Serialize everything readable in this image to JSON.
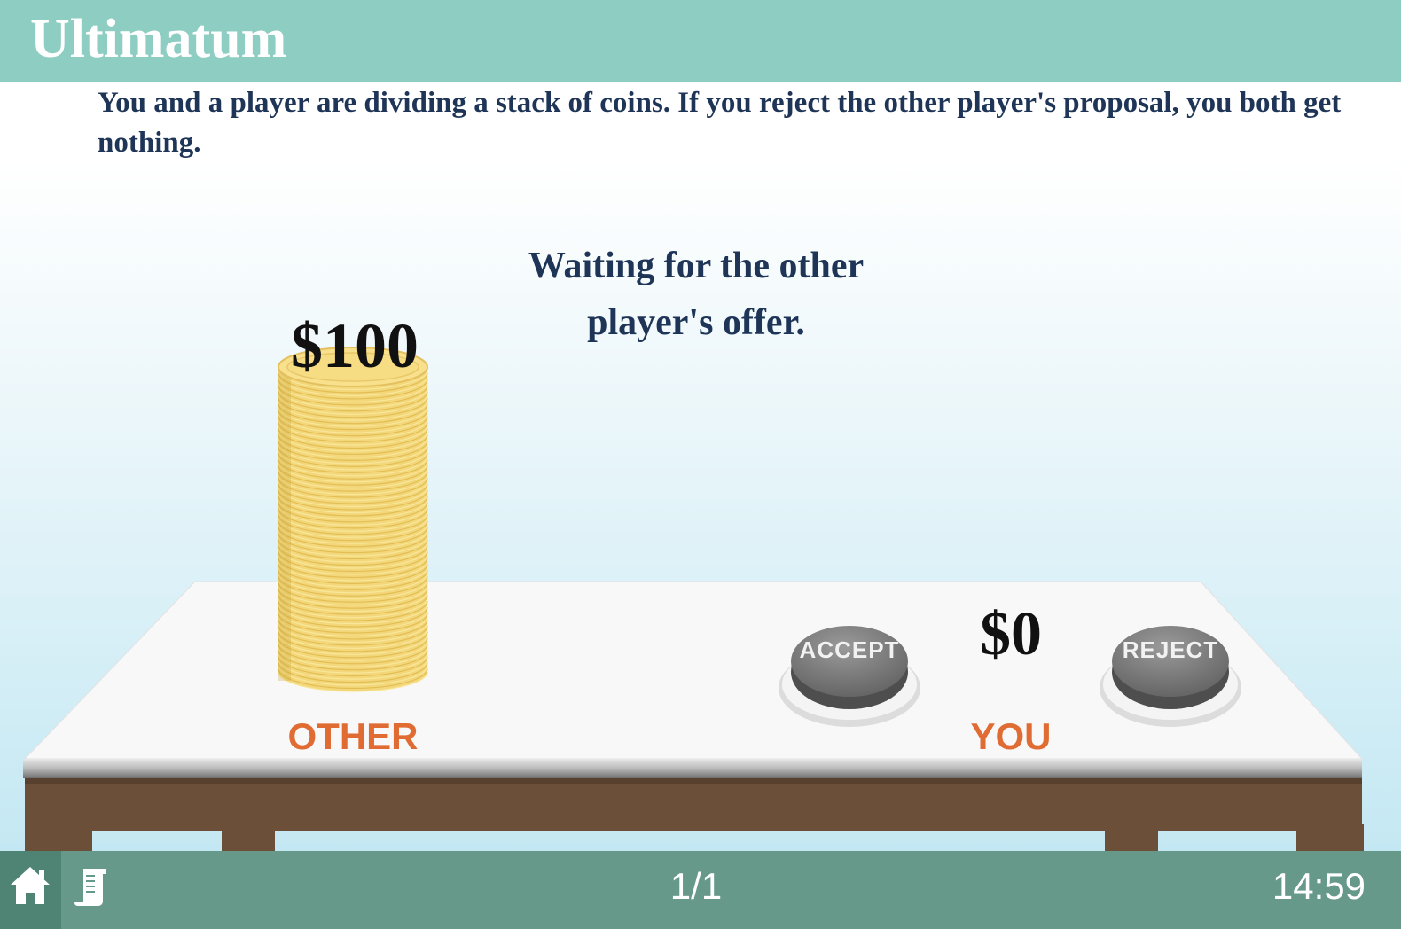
{
  "header": {
    "title": "Ultimatum"
  },
  "instructions": {
    "text": "You and a player are dividing a stack of coins. If you reject the other player's proposal, you both get nothing."
  },
  "status": {
    "message": "Waiting for the other player's offer."
  },
  "players": {
    "other": {
      "label": "OTHER",
      "amount": "$100",
      "coins": 100
    },
    "you": {
      "label": "YOU",
      "amount": "$0",
      "coins": 0
    }
  },
  "buttons": {
    "accept_label": "ACCEPT",
    "reject_label": "REJECT"
  },
  "footer": {
    "page": "1/1",
    "timer": "14:59",
    "icons": {
      "home": "home-icon",
      "notes": "notes-icon"
    }
  },
  "colors": {
    "header_bg": "#8ecdc2",
    "footer_bg": "#67998a",
    "text_navy": "#1f3557",
    "label_orange": "#e06c33",
    "coin_gold": "#f5d97a",
    "table_leg_brown": "#6b4f38"
  }
}
